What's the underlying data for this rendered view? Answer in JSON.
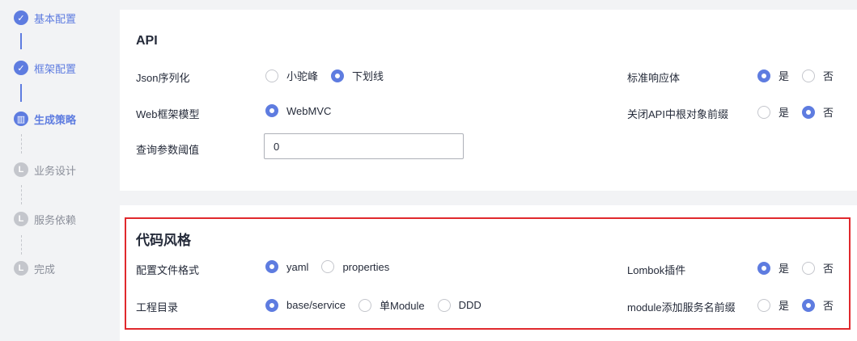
{
  "steps": [
    {
      "label": "基本配置",
      "state": "done",
      "icon": "check-icon",
      "glyph": "✓"
    },
    {
      "label": "框架配置",
      "state": "done",
      "icon": "check-icon",
      "glyph": "✓"
    },
    {
      "label": "生成策略",
      "state": "current",
      "icon": "strategy-icon",
      "glyph": "▥"
    },
    {
      "label": "业务设计",
      "state": "todo",
      "icon": "step-icon",
      "glyph": "L"
    },
    {
      "label": "服务依赖",
      "state": "todo",
      "icon": "step-icon",
      "glyph": "L"
    },
    {
      "label": "完成",
      "state": "todo",
      "icon": "step-icon",
      "glyph": "L"
    }
  ],
  "api": {
    "title": "API",
    "json_label": "Json序列化",
    "json_options": [
      "小驼峰",
      "下划线"
    ],
    "json_selected": 1,
    "web_label": "Web框架模型",
    "web_options": [
      "WebMVC"
    ],
    "web_selected": 0,
    "query_label": "查询参数阈值",
    "query_value": "0",
    "std_label": "标准响应体",
    "std_options": [
      "是",
      "否"
    ],
    "std_selected": 0,
    "close_label": "关闭API中根对象前缀",
    "close_options": [
      "是",
      "否"
    ],
    "close_selected": 1
  },
  "style": {
    "title": "代码风格",
    "config_label": "配置文件格式",
    "config_options": [
      "yaml",
      "properties"
    ],
    "config_selected": 0,
    "project_label": "工程目录",
    "project_options": [
      "base/service",
      "单Module",
      "DDD"
    ],
    "project_selected": 0,
    "lombok_label": "Lombok插件",
    "lombok_options": [
      "是",
      "否"
    ],
    "lombok_selected": 0,
    "module_label": "module添加服务名前缀",
    "module_options": [
      "是",
      "否"
    ],
    "module_selected": 1
  },
  "colors": {
    "accent": "#5e7ce0",
    "highlight": "#e0292d",
    "inactive": "#c4c6cc"
  }
}
